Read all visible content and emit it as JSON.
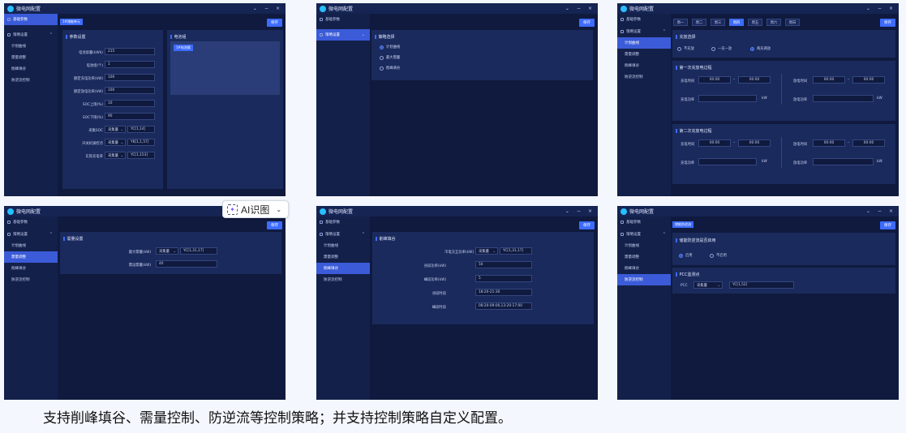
{
  "app_title": "微电网配置",
  "win": {
    "min": "⌄",
    "max": "−",
    "close": "×"
  },
  "save_label": "保存",
  "caption": "支持削峰填谷、需量控制、防逆流等控制策略；并支持控制策略自定义配置。",
  "ai_badge": {
    "label": "AI识图"
  },
  "sidebar": {
    "basic": "基础参数",
    "strategy": "策略设置",
    "plan": "计划曲线",
    "demand": "需量调整",
    "peak": "削峰填谷",
    "anti": "防逆流控制"
  },
  "p1": {
    "chip": "1#储能单元",
    "param_title": "参数设置",
    "cell_title": "电池组",
    "cell_chip": "1#电池簇",
    "rows": [
      {
        "label": "电池容量(kWh)",
        "value": "215"
      },
      {
        "label": "电池组(个)",
        "value": "1"
      },
      {
        "label": "额定充电功率(kW)",
        "value": "100"
      },
      {
        "label": "额定放电功率(kW)",
        "value": "100"
      },
      {
        "label": "SOC上限(%)",
        "value": "10"
      },
      {
        "label": "SOC下限(%)",
        "value": "90"
      }
    ],
    "sel_rows": [
      {
        "label": "采集SOC",
        "sel": "采集量",
        "value": "YC[1,14]"
      },
      {
        "label": "开关机调控点",
        "sel": "采集量",
        "value": "YK[1,1,57]"
      },
      {
        "label": "实际充电率",
        "sel": "采集量",
        "value": "YC[1,153]"
      }
    ]
  },
  "p2": {
    "title": "策略选择",
    "options": [
      "计划曲线",
      "最大需量",
      "削峰填谷"
    ]
  },
  "p3": {
    "tabs": [
      "周一",
      "周二",
      "周三",
      "周四",
      "周五",
      "周六",
      "周日"
    ],
    "mode_title": "充放选择",
    "modes": [
      "不充放",
      "一充一放",
      "两充两放"
    ],
    "first_title": "第一次充放电过程",
    "second_title": "第二次充放电过程",
    "charge_time": "充电时间",
    "discharge_time": "放电时间",
    "charge_power": "充电功率",
    "discharge_power": "放电功率",
    "t1": "00:00",
    "t2": "00:00",
    "unit_kw": "kW",
    "dash": "–"
  },
  "p4": {
    "title": "需量设置",
    "rows": [
      {
        "label": "最大需量(kW)",
        "sel": "采集量",
        "value": "YC[1,31,17]"
      },
      {
        "label": "需设需量(kW)",
        "value": "40"
      }
    ]
  },
  "p5": {
    "title": "削峰填谷",
    "sel_row": {
      "label": "市电交互功率(kW)",
      "sel": "采集量",
      "value": "YC[1,31,17]"
    },
    "rows": [
      {
        "label": "谷段功率(kW)",
        "value": "50"
      },
      {
        "label": "峰段功率(kW)",
        "value": "5"
      },
      {
        "label": "谷段时段",
        "value": "18:20-21:30"
      },
      {
        "label": "峰段时段",
        "value": "08:20-09:00,13:20-17:00"
      }
    ]
  },
  "p6": {
    "chip": "储能防逆流",
    "enable_title": "储能防逆流是否启用",
    "enable_opts": [
      "启用",
      "不启用"
    ],
    "pcc_title": "PCC监测点",
    "pcc_label": "PCC",
    "pcc_sel": "采集量",
    "pcc_value": "YC[1,52]"
  }
}
